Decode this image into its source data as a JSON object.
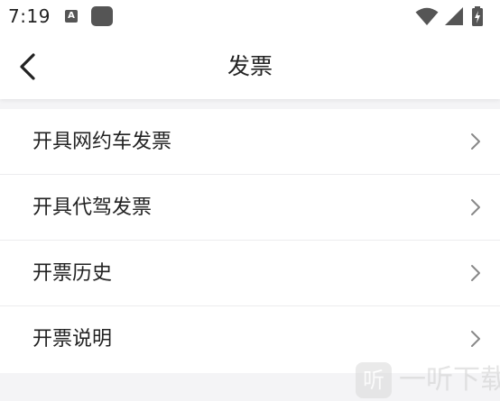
{
  "status_bar": {
    "time": "7:19",
    "a_icon_letter": "A",
    "icons": [
      "a-icon",
      "app-icon",
      "wifi-icon",
      "signal-icon",
      "battery-charging-icon"
    ]
  },
  "header": {
    "title": "发票",
    "back_icon": "chevron-left-icon"
  },
  "menu": {
    "items": [
      {
        "label": "开具网约车发票",
        "icon": "chevron-right-icon"
      },
      {
        "label": "开具代驾发票",
        "icon": "chevron-right-icon"
      },
      {
        "label": "开票历史",
        "icon": "chevron-right-icon"
      },
      {
        "label": "开票说明",
        "icon": "chevron-right-icon"
      }
    ]
  },
  "watermark": {
    "logo_char": "听",
    "text": "一听下载"
  },
  "colors": {
    "background": "#f4f4f6",
    "surface": "#ffffff",
    "text": "#222222",
    "divider": "#ececee",
    "chevron": "#888888"
  }
}
